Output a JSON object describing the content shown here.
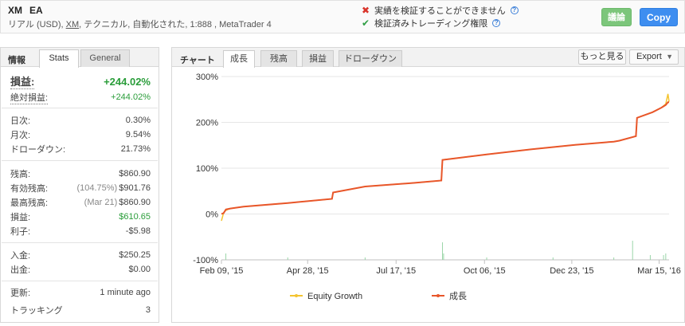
{
  "header": {
    "name": "XM",
    "name2": "EA",
    "sub_prefix": "リアル (USD), ",
    "sub_broker": "XM",
    "sub_suffix": ", テクニカル, 自動化された, 1:888 , MetaTrader 4",
    "verify_1": "実績を検証することができません",
    "verify_2": "検証済みトレーディング権限",
    "btn_green": "議論",
    "btn_copy": "Copy"
  },
  "left": {
    "title": "情報",
    "tab_stats": "Stats",
    "tab_general": "General",
    "stats": [
      {
        "label": "損益:",
        "value": "+244.02%"
      },
      {
        "label": "絶対損益:",
        "value": "+244.02%"
      },
      {
        "label": "日次:",
        "value": "0.30%"
      },
      {
        "label": "月次:",
        "value": "9.54%"
      },
      {
        "label": "ドローダウン:",
        "value": "21.73%"
      },
      {
        "label": "残高:",
        "value": "$860.90"
      },
      {
        "label": "有効残高:",
        "pre": "(104.75%)",
        "value": "$901.76"
      },
      {
        "label": "最高残高:",
        "pre": "(Mar 21)",
        "value": "$860.90"
      },
      {
        "label": "損益:",
        "value": "$610.65"
      },
      {
        "label": "利子:",
        "value": "-$5.98"
      },
      {
        "label": "入金:",
        "value": "$250.25"
      },
      {
        "label": "出金:",
        "value": "$0.00"
      },
      {
        "label": "更新:",
        "value": "1 minute ago"
      },
      {
        "label": "トラッキング",
        "value": "3"
      }
    ]
  },
  "right": {
    "title": "チャート",
    "tabs": [
      "成長",
      "残高",
      "損益",
      "ドローダウン"
    ],
    "more": "もっと見る",
    "export": "Export"
  },
  "colors": {
    "growth": "#e8562a",
    "equity": "#f4c430",
    "bars": "#9ad5a8",
    "positive": "#2a9d3a"
  },
  "chart_data": {
    "type": "line",
    "x_ticks": [
      "Feb 09, '15",
      "Apr 28, '15",
      "Jul 17, '15",
      "Oct 06, '15",
      "Dec 23, '15",
      "Mar 15, '16"
    ],
    "y_ticks": [
      "300%",
      "200%",
      "100%",
      "0%",
      "-100%"
    ],
    "ylim": [
      -100,
      300
    ],
    "x_range": [
      0,
      405
    ],
    "series": [
      {
        "name": "Equity Growth",
        "x": [
          0,
          2,
          4,
          8,
          20,
          60,
          100,
          101,
          130,
          175,
          199,
          200,
          240,
          280,
          320,
          355,
          360,
          375,
          376,
          390,
          398,
          402,
          404,
          405
        ],
        "values": [
          -15,
          3,
          8,
          12,
          16,
          24,
          33,
          47,
          60,
          68,
          73,
          118,
          130,
          141,
          151,
          158,
          160,
          170,
          210,
          222,
          232,
          240,
          262,
          245
        ]
      },
      {
        "name": "成長",
        "x": [
          0,
          2,
          4,
          8,
          20,
          60,
          100,
          101,
          130,
          175,
          199,
          200,
          240,
          280,
          320,
          355,
          360,
          375,
          376,
          390,
          398,
          402,
          404,
          405
        ],
        "values": [
          0,
          2,
          10,
          12,
          16,
          24,
          33,
          47,
          60,
          68,
          73,
          118,
          130,
          141,
          151,
          158,
          160,
          170,
          210,
          222,
          232,
          238,
          244,
          244
        ]
      }
    ]
  }
}
